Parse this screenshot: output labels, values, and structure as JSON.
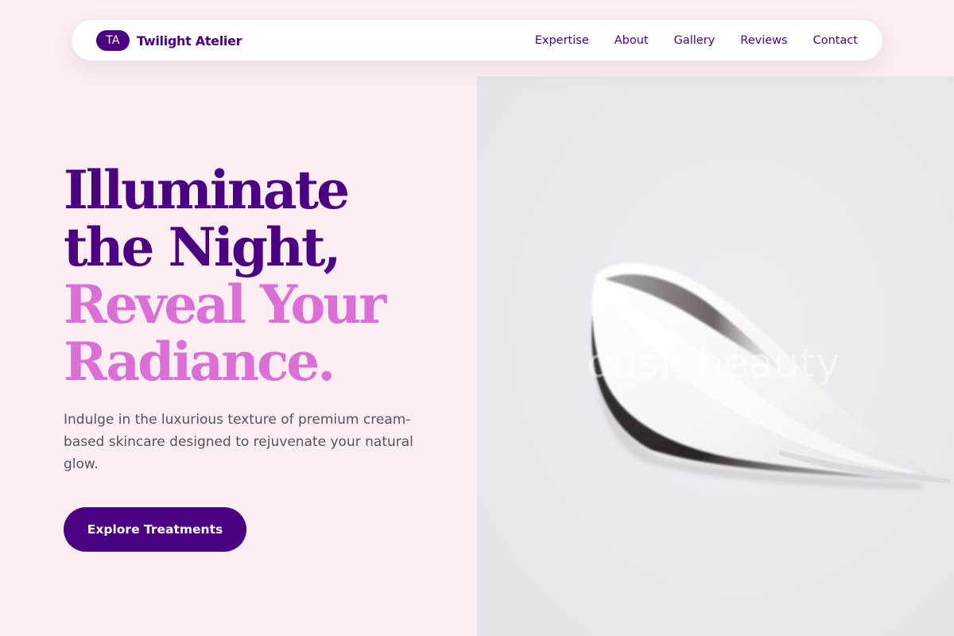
{
  "brand": {
    "initials": "TA",
    "name": "Twilight Atelier"
  },
  "nav": {
    "links": [
      "Expertise",
      "About",
      "Gallery",
      "Reviews",
      "Contact"
    ]
  },
  "hero": {
    "headline_dark": [
      "Illuminate",
      "the Night,"
    ],
    "headline_light": [
      "Reveal Your",
      "Radiance."
    ],
    "subtext": "Indulge in the luxurious texture of premium cream-based skincare designed to rejuvenate your natural glow.",
    "cta_label": "Explore Treatments",
    "image_watermark": "dusk.beauty"
  },
  "colors": {
    "page_background": "#fdeef4",
    "primary": "#4b0082",
    "accent": "#da70d6",
    "body_text": "#55525f",
    "image_background": "#e9e7ec"
  },
  "icons": {
    "logo": "initials-badge"
  }
}
